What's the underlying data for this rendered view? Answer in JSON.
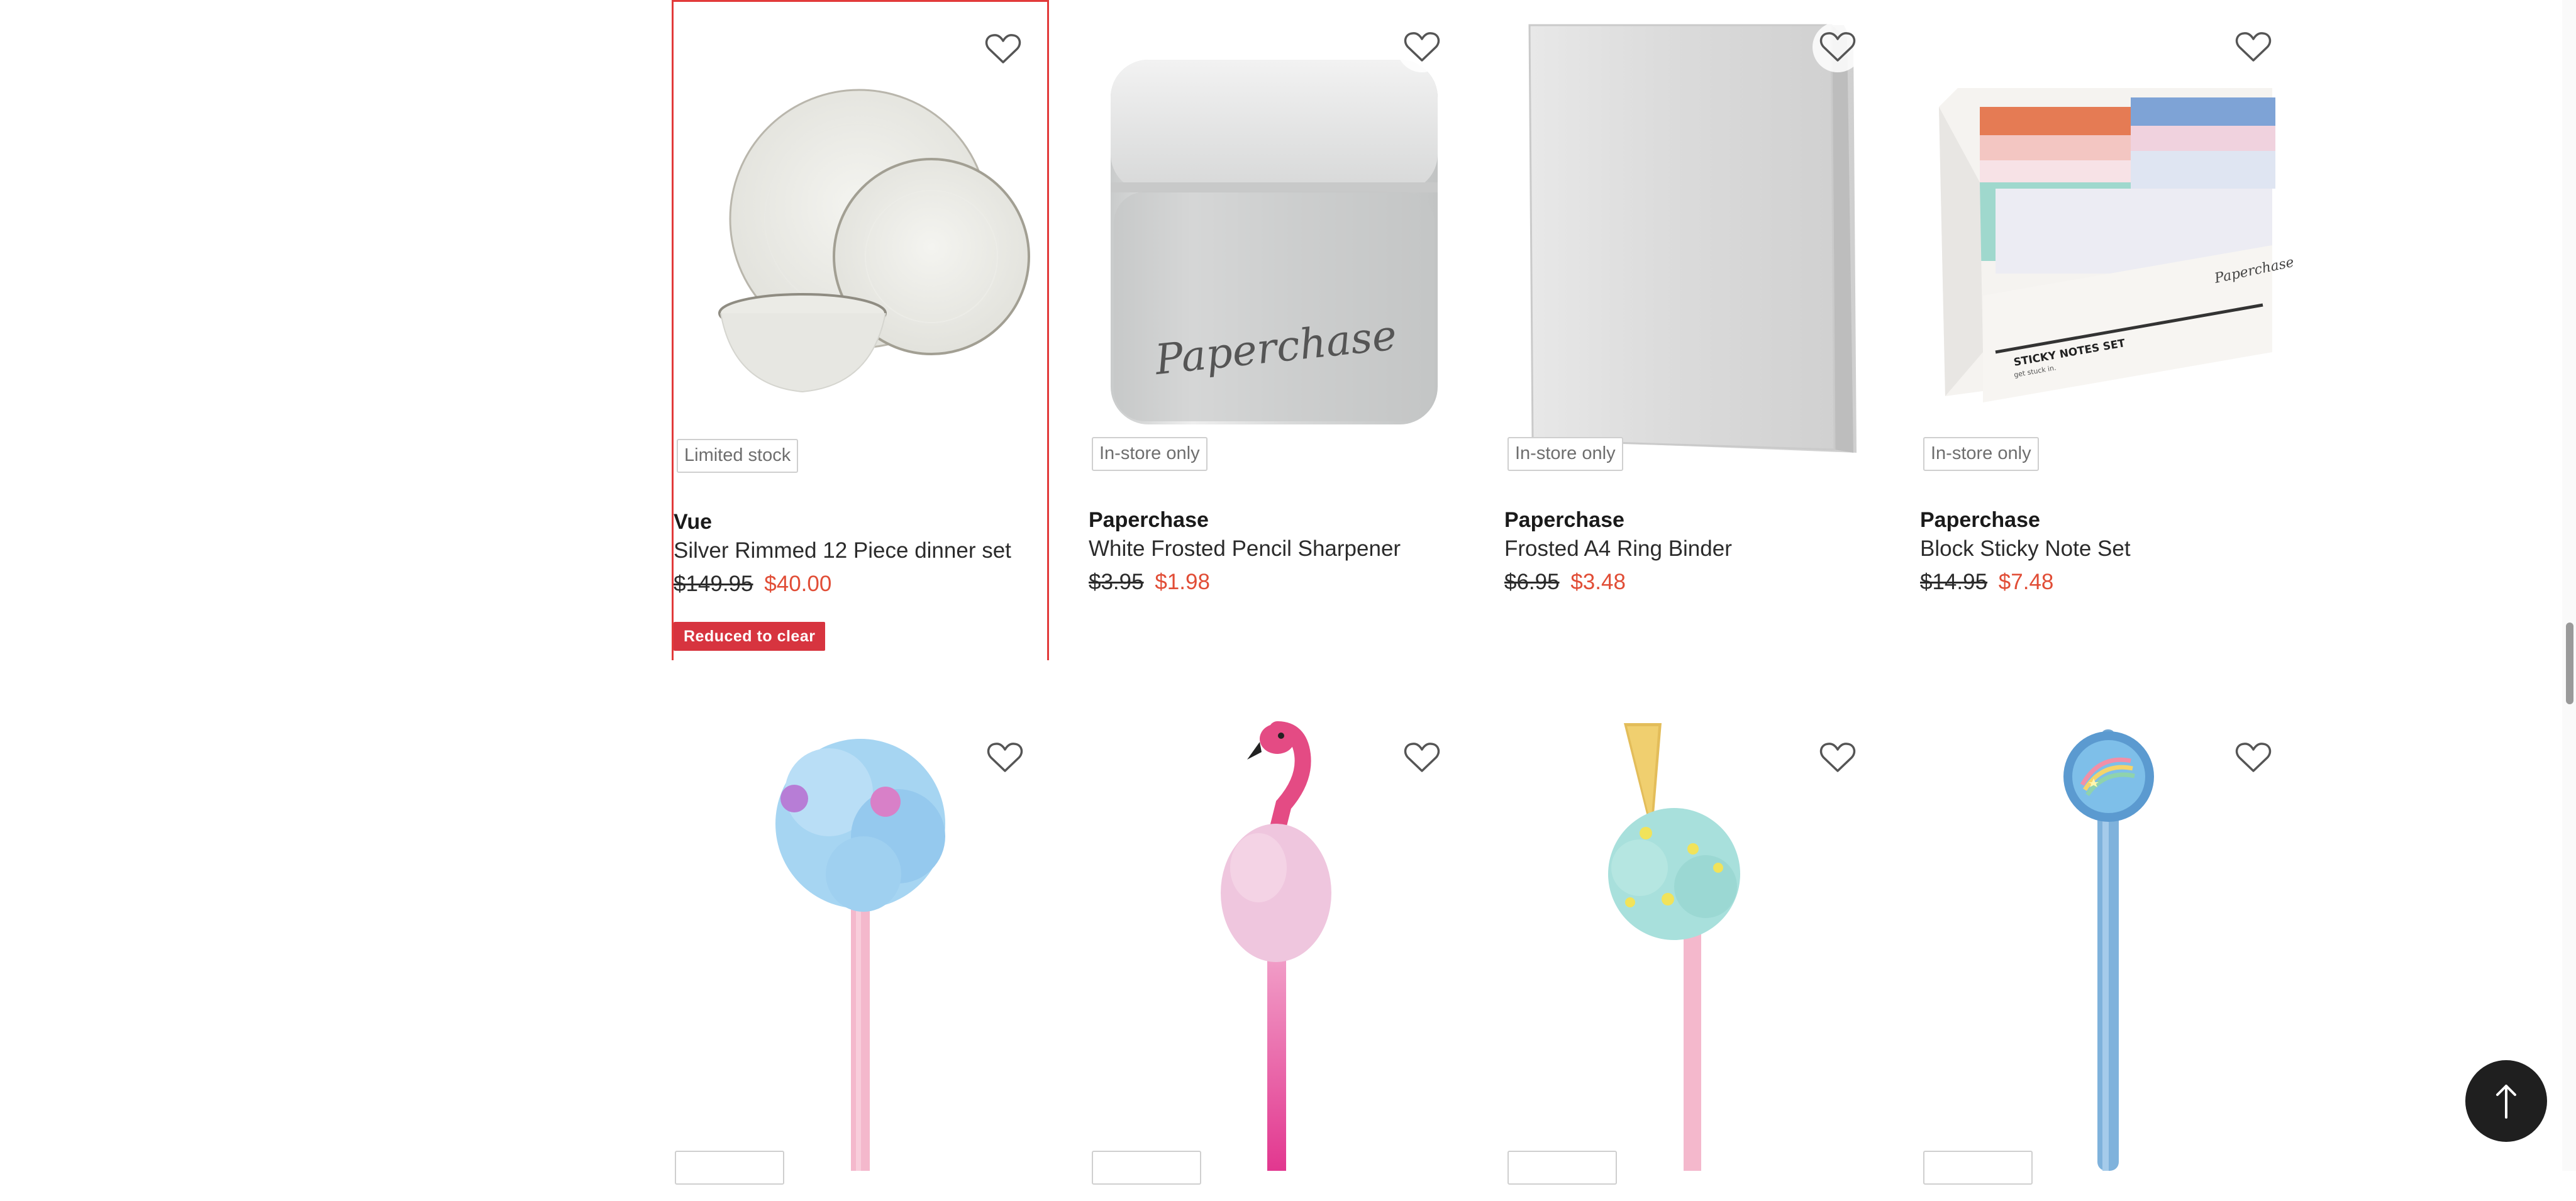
{
  "colors": {
    "accent_red": "#e23a3a",
    "sale_price": "#e14d36",
    "badge_bg": "#d7343f",
    "button_dark": "#1f1f1f"
  },
  "products": [
    {
      "brand": "Vue",
      "name": "Silver Rimmed 12 Piece dinner set",
      "was_price": "$149.95",
      "now_price": "$40.00",
      "tag": "Limited stock",
      "badge": "Reduced to clear",
      "icon": "heart-icon"
    },
    {
      "brand": "Paperchase",
      "name": "White Frosted Pencil Sharpener",
      "was_price": "$3.95",
      "now_price": "$1.98",
      "tag": "In-store only",
      "icon": "heart-icon"
    },
    {
      "brand": "Paperchase",
      "name": "Frosted A4 Ring Binder",
      "was_price": "$6.95",
      "now_price": "$3.48",
      "tag": "In-store only",
      "icon": "heart-icon"
    },
    {
      "brand": "Paperchase",
      "name": "Block Sticky Note Set",
      "was_price": "$14.95",
      "now_price": "$7.48",
      "tag": "In-store only",
      "icon": "heart-icon"
    }
  ],
  "back_to_top": {
    "icon": "arrow-up-icon"
  }
}
